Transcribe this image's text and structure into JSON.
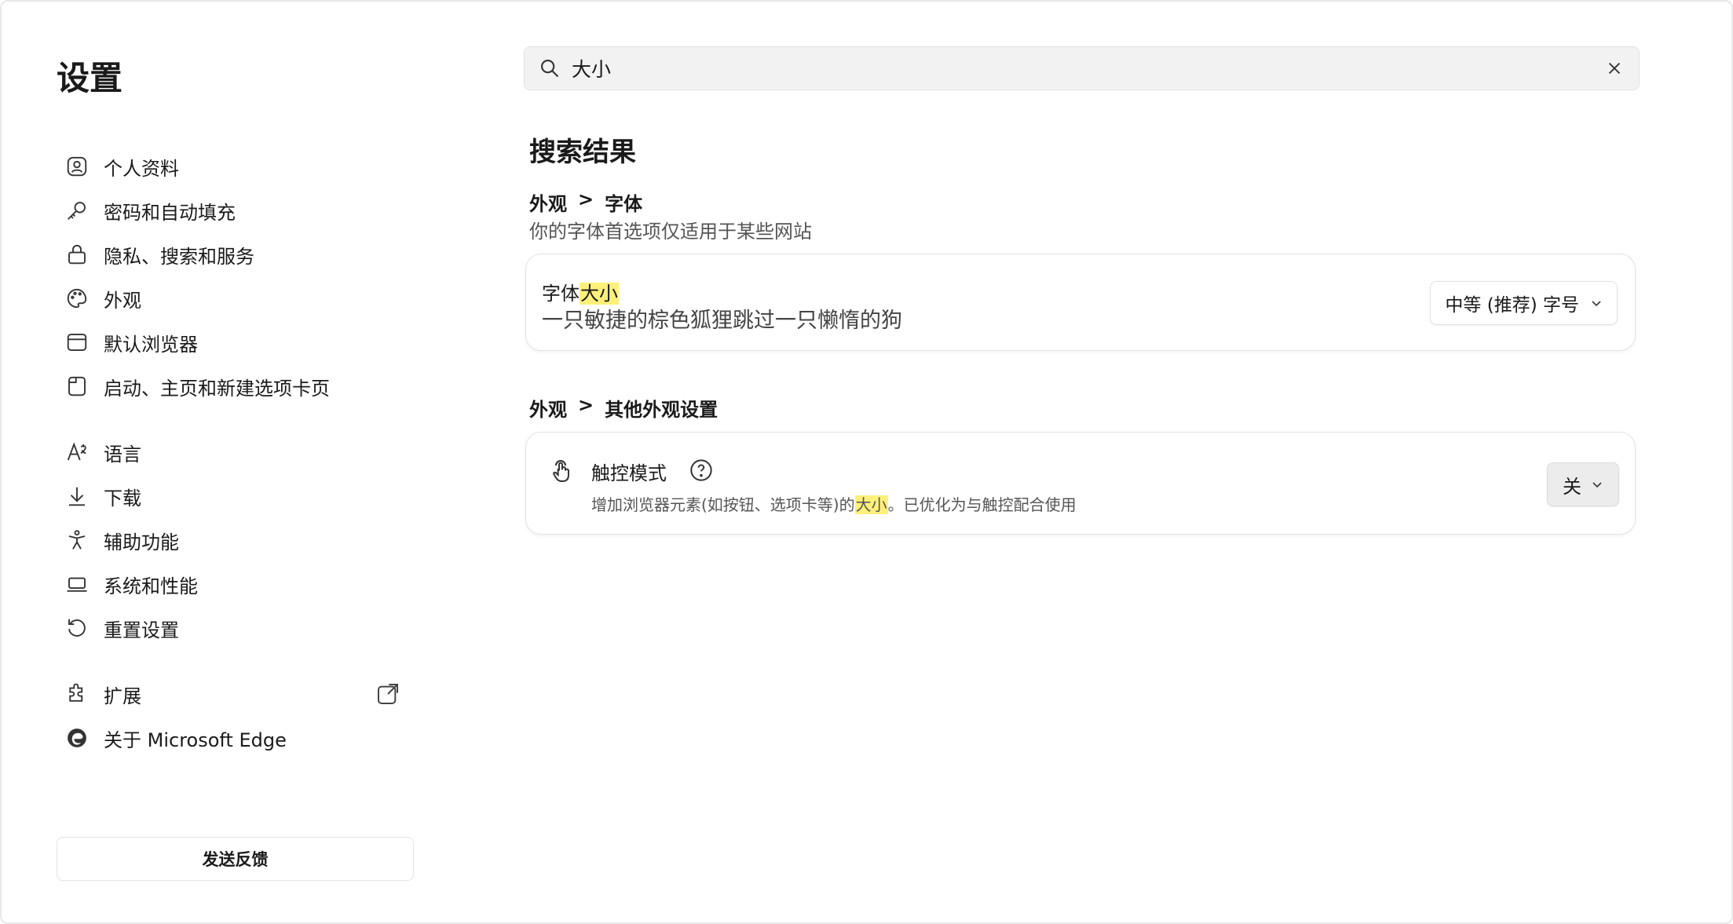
{
  "sidebar": {
    "title": "设置",
    "items": [
      {
        "label": "个人资料"
      },
      {
        "label": "密码和自动填充"
      },
      {
        "label": "隐私、搜索和服务"
      },
      {
        "label": "外观"
      },
      {
        "label": "默认浏览器"
      },
      {
        "label": "启动、主页和新建选项卡页"
      },
      {
        "label": "语言"
      },
      {
        "label": "下载"
      },
      {
        "label": "辅助功能"
      },
      {
        "label": "系统和性能"
      },
      {
        "label": "重置设置"
      },
      {
        "label": "扩展"
      },
      {
        "label": "关于 Microsoft Edge"
      }
    ],
    "feedback_label": "发送反馈"
  },
  "search": {
    "value": "大小"
  },
  "results": {
    "title": "搜索结果",
    "section1": {
      "crumb_parent": "外观",
      "crumb_sep": ">",
      "crumb_child": "字体",
      "description": "你的字体首选项仅适用于某些网站",
      "setting_prefix": "字体",
      "setting_highlight": "大小",
      "sample_text": "一只敏捷的棕色狐狸跳过一只懒惰的狗",
      "select_value": "中等 (推荐) 字号"
    },
    "section2": {
      "crumb_parent": "外观",
      "crumb_sep": ">",
      "crumb_child": "其他外观设置",
      "setting_title": "触控模式",
      "desc_prefix": "增加浏览器元素(如按钮、选项卡等)的",
      "desc_highlight": "大小",
      "desc_suffix": "。已优化为与触控配合使用",
      "toggle_value": "关"
    }
  },
  "colors": {
    "highlight": "#fff07a",
    "text": "#1a1a1a",
    "secondary_text": "#555555"
  }
}
